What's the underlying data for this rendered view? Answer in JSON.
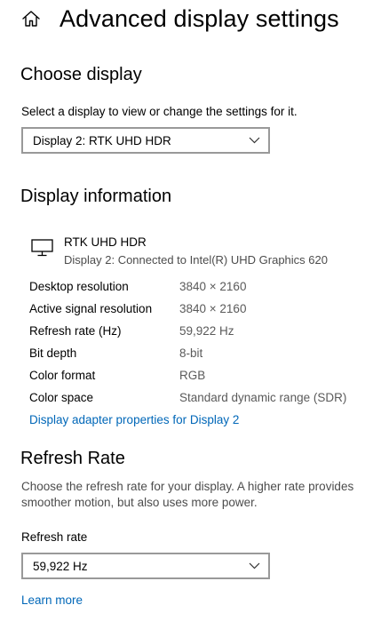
{
  "header": {
    "title": "Advanced display settings",
    "home_icon": "home-icon"
  },
  "choose_display": {
    "heading": "Choose display",
    "description": "Select a display to view or change the settings for it.",
    "selected_display": "Display 2: RTK UHD HDR"
  },
  "display_information": {
    "heading": "Display information",
    "monitor_icon": "monitor-icon",
    "monitor_name": "RTK UHD HDR",
    "monitor_connection": "Display 2: Connected to Intel(R) UHD Graphics 620",
    "rows": [
      {
        "label": "Desktop resolution",
        "value": "3840 × 2160"
      },
      {
        "label": "Active signal resolution",
        "value": "3840 × 2160"
      },
      {
        "label": "Refresh rate (Hz)",
        "value": "59,922 Hz"
      },
      {
        "label": "Bit depth",
        "value": "8-bit"
      },
      {
        "label": "Color format",
        "value": "RGB"
      },
      {
        "label": "Color space",
        "value": "Standard dynamic range (SDR)"
      }
    ],
    "adapter_link": "Display adapter properties for Display 2"
  },
  "refresh_rate": {
    "heading": "Refresh Rate",
    "description_line1": "Choose the refresh rate for your display. A higher rate provides",
    "description_line2": "smoother motion, but also uses more power.",
    "field_label": "Refresh rate",
    "selected_rate": "59,922 Hz",
    "learn_more_link": "Learn more"
  },
  "colors": {
    "link": "#0067b8",
    "dropdown_border": "#999999",
    "secondary_text": "#5a5a5a"
  }
}
